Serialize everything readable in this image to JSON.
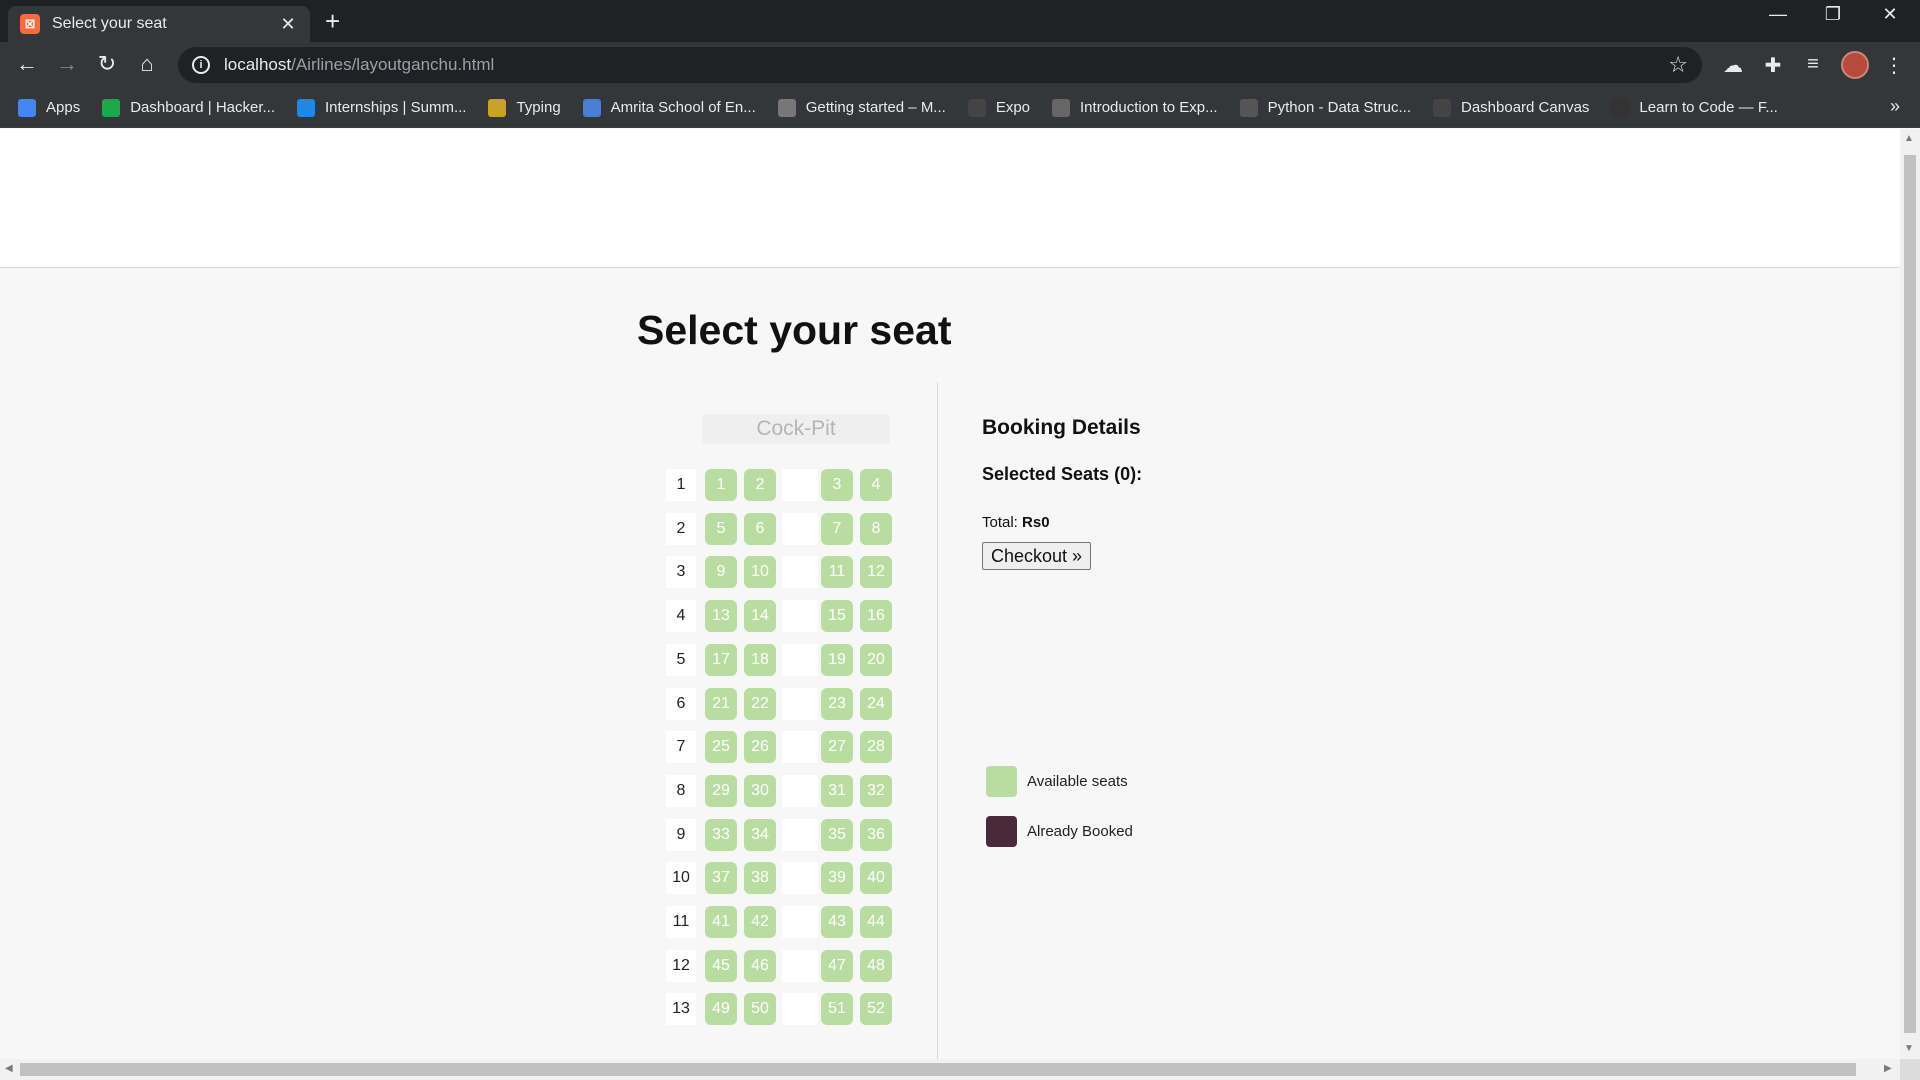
{
  "browser": {
    "tab_title": "Select your seat",
    "tab_icon": "xampp-icon",
    "url_host": "localhost",
    "url_path": "/Airlines/layoutganchu.html",
    "bookmarks": [
      {
        "label": "Apps",
        "icon": "apps-grid-icon",
        "color": "#4285f4"
      },
      {
        "label": "Dashboard | Hacker...",
        "icon": "hackerrank-icon",
        "color": "#1ba94c"
      },
      {
        "label": "Internships | Summ...",
        "icon": "internshala-icon",
        "color": "#1e88e5"
      },
      {
        "label": "Typing",
        "icon": "typing-icon",
        "color": "#c9a227"
      },
      {
        "label": "Amrita School of En...",
        "icon": "amrita-icon",
        "color": "#4a7fd6"
      },
      {
        "label": "Getting started – M...",
        "icon": "gear-icon",
        "color": "#777777"
      },
      {
        "label": "Expo",
        "icon": "expo-icon",
        "color": "#444444"
      },
      {
        "label": "Introduction to Exp...",
        "icon": "intro-icon",
        "color": "#666666"
      },
      {
        "label": "Python - Data Struc...",
        "icon": "python-icon",
        "color": "#555555"
      },
      {
        "label": "Dashboard Canvas",
        "icon": "aws-icon",
        "color": "#444444"
      },
      {
        "label": "Learn to Code — F...",
        "icon": "freecodecamp-icon",
        "color": "#333333"
      }
    ]
  },
  "page": {
    "title": "Select your seat",
    "cockpit_label": "Cock-Pit",
    "rows": [
      {
        "num": "1",
        "left": [
          "1",
          "2"
        ],
        "right": [
          "3",
          "4"
        ]
      },
      {
        "num": "2",
        "left": [
          "5",
          "6"
        ],
        "right": [
          "7",
          "8"
        ]
      },
      {
        "num": "3",
        "left": [
          "9",
          "10"
        ],
        "right": [
          "11",
          "12"
        ]
      },
      {
        "num": "4",
        "left": [
          "13",
          "14"
        ],
        "right": [
          "15",
          "16"
        ]
      },
      {
        "num": "5",
        "left": [
          "17",
          "18"
        ],
        "right": [
          "19",
          "20"
        ]
      },
      {
        "num": "6",
        "left": [
          "21",
          "22"
        ],
        "right": [
          "23",
          "24"
        ]
      },
      {
        "num": "7",
        "left": [
          "25",
          "26"
        ],
        "right": [
          "27",
          "28"
        ]
      },
      {
        "num": "8",
        "left": [
          "29",
          "30"
        ],
        "right": [
          "31",
          "32"
        ]
      },
      {
        "num": "9",
        "left": [
          "33",
          "34"
        ],
        "right": [
          "35",
          "36"
        ]
      },
      {
        "num": "10",
        "left": [
          "37",
          "38"
        ],
        "right": [
          "39",
          "40"
        ]
      },
      {
        "num": "11",
        "left": [
          "41",
          "42"
        ],
        "right": [
          "43",
          "44"
        ]
      },
      {
        "num": "12",
        "left": [
          "45",
          "46"
        ],
        "right": [
          "47",
          "48"
        ]
      },
      {
        "num": "13",
        "left": [
          "49",
          "50"
        ],
        "right": [
          "51",
          "52"
        ]
      }
    ],
    "booking": {
      "title": "Booking Details",
      "selected_label": "Selected Seats (0):",
      "total_label": "Total: ",
      "total_value": "Rs0",
      "checkout_label": "Checkout »"
    },
    "legend": [
      {
        "label": "Available seats",
        "color": "#b9dca1"
      },
      {
        "label": "Already Booked",
        "color": "#4a2a38"
      }
    ],
    "colors": {
      "available_seat": "#b9dca1",
      "booked_seat": "#4a2a38"
    }
  }
}
